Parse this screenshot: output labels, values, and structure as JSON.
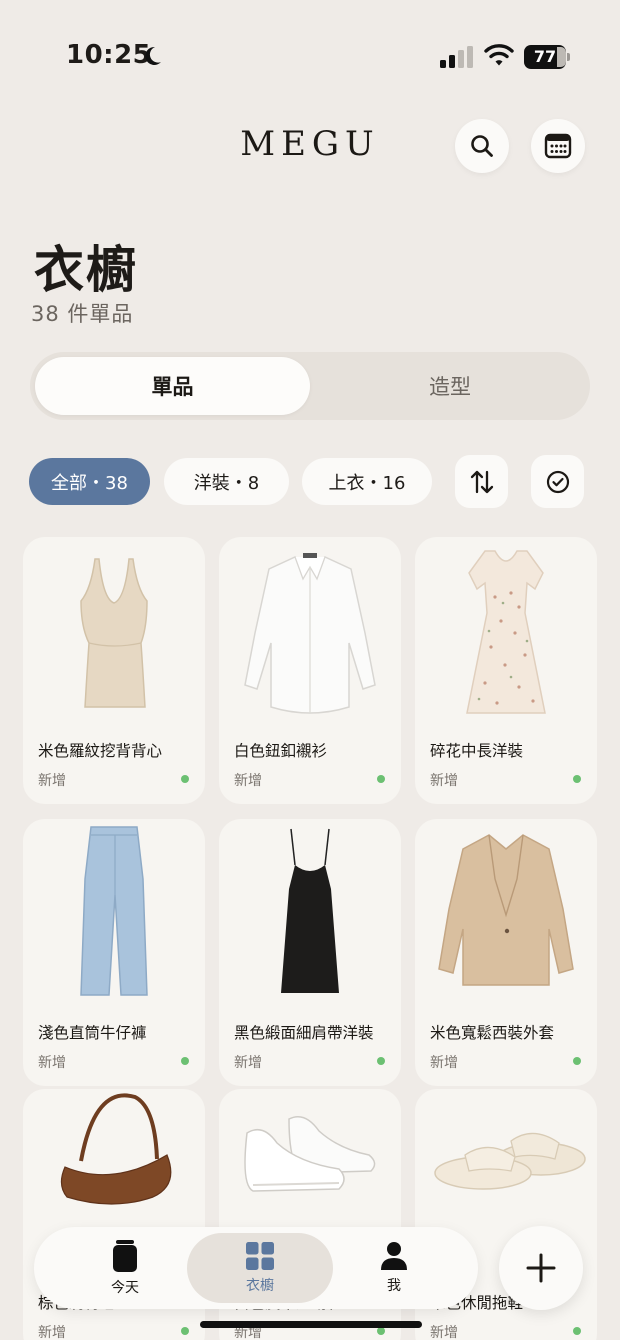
{
  "status_bar": {
    "time": "10:25",
    "battery": "77",
    "battery_level": 0.77
  },
  "header": {
    "brand": "MEGU"
  },
  "page": {
    "title": "衣櫥",
    "count": "38 件單品"
  },
  "segments": [
    "單品",
    "造型"
  ],
  "filters": {
    "all": "全部・38",
    "dress": "洋裝・8",
    "tops": "上衣・16"
  },
  "items": [
    {
      "name": "米色羅紋挖背背心",
      "tag": "新增",
      "image": "beige-tank-top"
    },
    {
      "name": "白色鈕釦襯衫",
      "tag": "新增",
      "image": "white-shirt"
    },
    {
      "name": "碎花中長洋裝",
      "tag": "新增",
      "image": "floral-dress"
    },
    {
      "name": "淺色直筒牛仔褲",
      "tag": "新增",
      "image": "light-jeans"
    },
    {
      "name": "黑色緞面細肩帶洋裝",
      "tag": "新增",
      "image": "black-slip-dress"
    },
    {
      "name": "米色寬鬆西裝外套",
      "tag": "新增",
      "image": "beige-blazer"
    },
    {
      "name": "棕色肩背包",
      "tag": "新增",
      "image": "brown-shoulder-bag"
    },
    {
      "name": "白色皮革運動鞋",
      "tag": "新增",
      "image": "white-sneakers"
    },
    {
      "name": "米色休閒拖鞋",
      "tag": "新增",
      "image": "beige-slides"
    }
  ],
  "nav": {
    "today": "今天",
    "closet": "衣櫥",
    "me": "我"
  },
  "colors": {
    "accent": "#5b779e",
    "background": "#efebe7",
    "new_dot": "#6cc072",
    "card": "#f7f5f1"
  },
  "icons": [
    "moon-icon",
    "signal-icon",
    "wifi-icon",
    "search-icon",
    "calendar-icon",
    "sort-icon",
    "check-circle-icon",
    "today-icon",
    "closet-grid-icon",
    "profile-icon",
    "plus-icon"
  ]
}
